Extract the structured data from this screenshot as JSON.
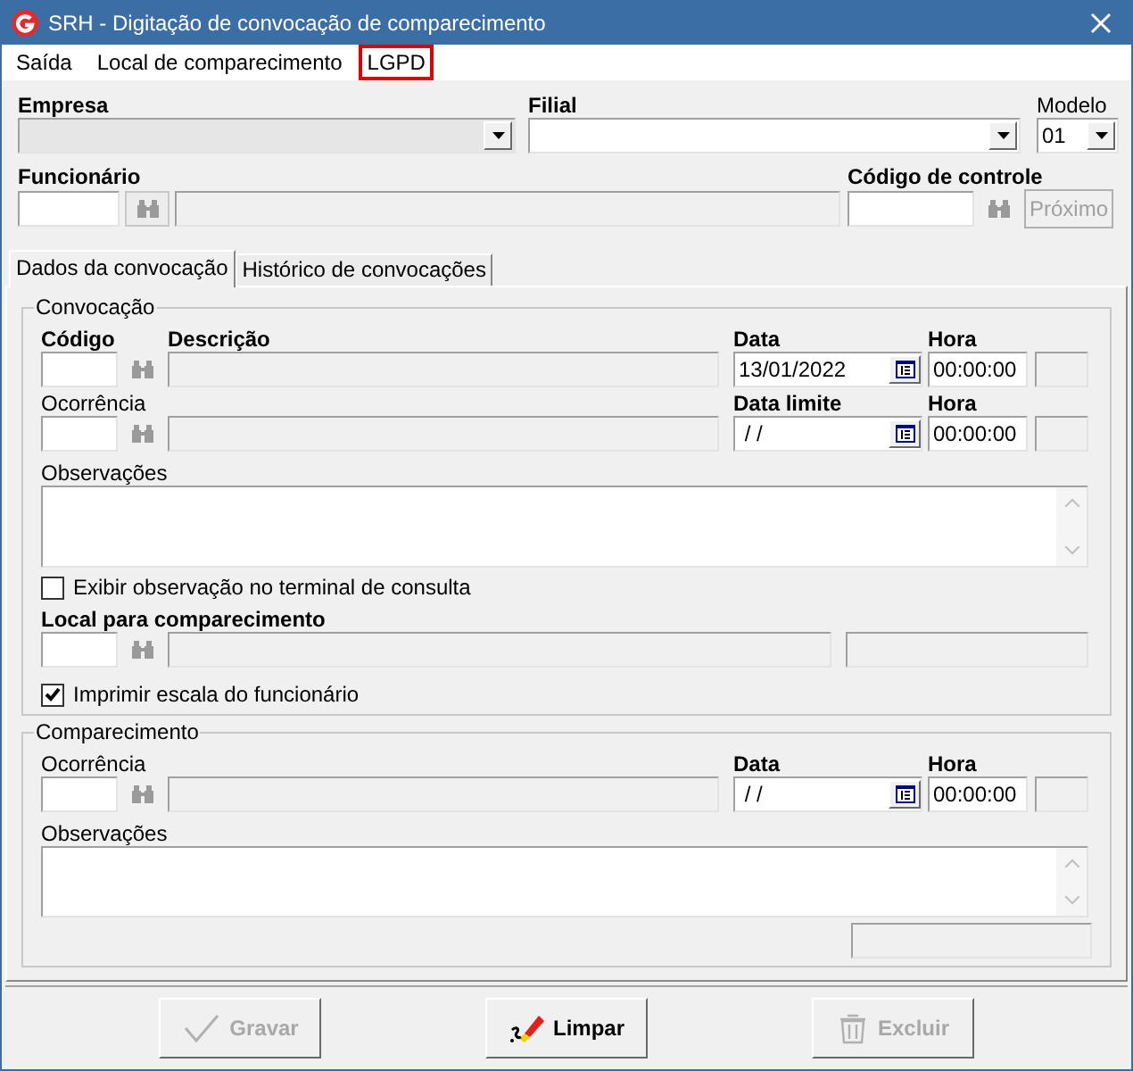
{
  "window": {
    "title": "SRH - Digitação de convocação de comparecimento"
  },
  "menu": [
    {
      "label": "Saída",
      "highlighted": false
    },
    {
      "label": "Local de comparecimento",
      "highlighted": false
    },
    {
      "label": "LGPD",
      "highlighted": true
    }
  ],
  "header": {
    "empresa_label": "Empresa",
    "filial_label": "Filial",
    "modelo_label": "Modelo",
    "modelo_value": "01",
    "funcionario_label": "Funcionário",
    "codigo_controle_label": "Código de controle",
    "proximo": {
      "label": "Próximo",
      "disabled": true
    }
  },
  "tabs": [
    {
      "label": "Dados da convocação",
      "selected": true
    },
    {
      "label": "Histórico de convocações",
      "selected": false
    }
  ],
  "convocacao": {
    "title": "Convocação",
    "codigo_label": "Código",
    "descricao_label": "Descrição",
    "data_label": "Data",
    "data_value": "13/01/2022",
    "hora_label": "Hora",
    "hora_value": "00:00:00",
    "ocorrencia_label": "Ocorrência",
    "data_limite_label": "Data limite",
    "data_limite_value": "/ /",
    "hora2_label": "Hora",
    "hora2_value": "00:00:00",
    "observacoes_label": "Observações",
    "checkbox_exibir": {
      "label": "Exibir observação no terminal de consulta",
      "checked": false
    },
    "local_label": "Local para comparecimento",
    "checkbox_imprimir": {
      "label": "Imprimir escala do funcionário",
      "checked": true
    }
  },
  "comparecimento": {
    "title": "Comparecimento",
    "ocorrencia_label": "Ocorrência",
    "data_label": "Data",
    "data_value": "/ /",
    "hora_label": "Hora",
    "hora_value": "00:00:00",
    "observacoes_label": "Observações"
  },
  "buttons": [
    {
      "kind": "save",
      "label": "Gravar",
      "disabled": true
    },
    {
      "kind": "clear",
      "label": "Limpar",
      "disabled": false
    },
    {
      "kind": "delete",
      "label": "Excluir",
      "disabled": true
    }
  ]
}
